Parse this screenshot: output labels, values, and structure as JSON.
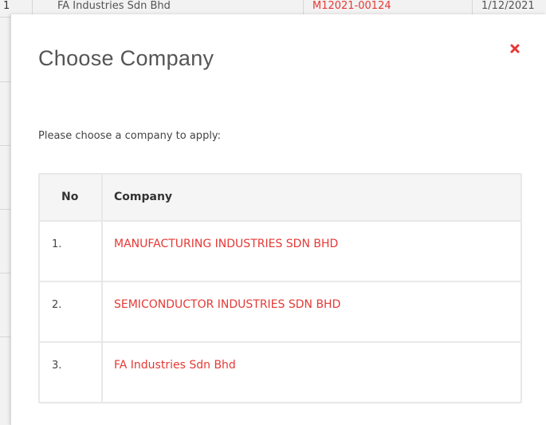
{
  "backdrop": {
    "row": [
      "1",
      "FA Industries Sdn Bhd",
      "M12021-00124",
      "1/12/2021"
    ]
  },
  "modal": {
    "title": "Choose Company",
    "close_icon": "close-icon",
    "instruction": "Please choose a company to apply:",
    "table": {
      "headers": [
        "No",
        "Company"
      ],
      "rows": [
        {
          "no": "1.",
          "company": "MANUFACTURING INDUSTRIES SDN BHD"
        },
        {
          "no": "2.",
          "company": "SEMICONDUCTOR INDUSTRIES SDN BHD"
        },
        {
          "no": "3.",
          "company": "FA Industries Sdn Bhd"
        }
      ]
    }
  },
  "colors": {
    "accent": "#e53935",
    "backdrop": "#b5b5b5"
  }
}
